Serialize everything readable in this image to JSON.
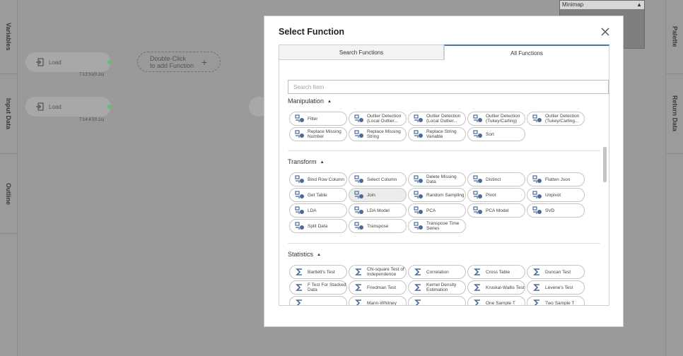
{
  "left_rail": {
    "tabs": [
      "Variables",
      "Input Data",
      "Outline"
    ]
  },
  "right_rail": {
    "tabs": [
      "Palette",
      "Return Data"
    ]
  },
  "canvas": {
    "nodes": [
      {
        "label": "Load",
        "time": "7:13:51(0.2s)"
      },
      {
        "label": "Load",
        "time": "7:14:47(0.1s)"
      }
    ],
    "add_function": {
      "line1": "Double-Click",
      "line2": "to add Function",
      "plus": "+"
    }
  },
  "minimap": {
    "title": "Minimap",
    "chevron": "^"
  },
  "modal": {
    "title": "Select Function",
    "tabs": [
      {
        "label": "Search Functions",
        "active": false
      },
      {
        "label": "All Functions",
        "active": true
      }
    ],
    "search": {
      "placeholder": "Search Item",
      "value": ""
    },
    "sections": [
      {
        "name": "Manipulation",
        "items": [
          "Filter",
          "Outlier Detection (Local Outlier...",
          "Outlier Detection (Local Outlier...",
          "Outlier Detection (Tukey/Carling)",
          "Outlier Detection (Tukey/Carling...",
          "Replace Missing Number",
          "Replace Missing String",
          "Replace String Variable",
          "Sort"
        ]
      },
      {
        "name": "Transform",
        "items": [
          "Bind Row Column",
          "Select Column",
          "Delete Missing Data",
          "Distinct",
          "Flatten Json",
          "Get Table",
          "Join",
          "Random Sampling",
          "Pivot",
          "Unpivot",
          "LDA",
          "LDA Model",
          "PCA",
          "PCA Model",
          "SVD",
          "Split Data",
          "Transpose",
          "Transpose Time Series"
        ]
      },
      {
        "name": "Statistics",
        "items": [
          "Bartlett's Test",
          "Chi-square Test of Independence",
          "Correlation",
          "Cross Table",
          "Duncan Test",
          "F Test For Stacked Data",
          "Friedman Test",
          "Kernel Density Estimation",
          "Kruskal-Wallis Test",
          "Levene's Test",
          "",
          "Mann-Whitney",
          "",
          "One Sample T",
          "Two Sample T"
        ]
      }
    ],
    "selected_item": "Join"
  },
  "colors": {
    "accent": "#4b74b0",
    "icon": "#4a6b99",
    "node_status": "#5fbf6a"
  }
}
